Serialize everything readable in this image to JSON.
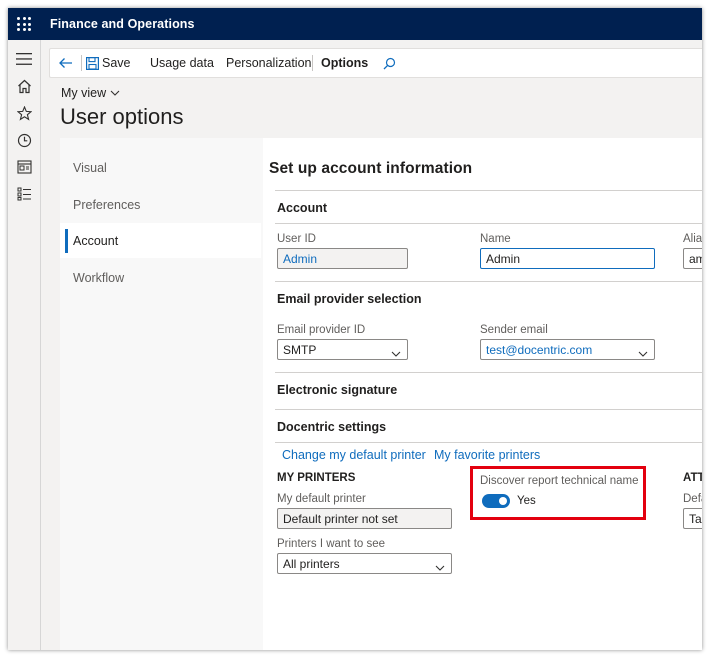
{
  "app": {
    "title": "Finance and Operations"
  },
  "action_pane": {
    "save_label": "Save",
    "usage_label": "Usage data",
    "personalization_label": "Personalization",
    "options_label": "Options"
  },
  "page": {
    "view_label": "My view",
    "title": "User options"
  },
  "tabs": [
    {
      "label": "Visual"
    },
    {
      "label": "Preferences"
    },
    {
      "label": "Account",
      "active": true
    },
    {
      "label": "Workflow"
    }
  ],
  "content": {
    "title": "Set up account information",
    "account": {
      "header": "Account",
      "user_id_label": "User ID",
      "user_id_value": "Admin",
      "name_label": "Name",
      "name_value": "Admin",
      "alias_label": "Alia",
      "alias_value": "am"
    },
    "email": {
      "header": "Email provider selection",
      "provider_label": "Email provider ID",
      "provider_value": "SMTP",
      "sender_label": "Sender email",
      "sender_value": "test@docentric.com"
    },
    "esig": {
      "header": "Electronic signature"
    },
    "docentric": {
      "header": "Docentric settings",
      "link_change_printer": "Change my default printer",
      "link_favorite_printers": "My favorite printers",
      "my_printers_header": "MY PRINTERS",
      "default_printer_label": "My default printer",
      "default_printer_value": "Default printer not set",
      "printers_see_label": "Printers I want to see",
      "printers_see_value": "All printers",
      "discover_label": "Discover report technical name",
      "discover_state": "Yes",
      "attach_header": "ATT",
      "attach_label": "Defa",
      "attach_value": "Tab"
    }
  },
  "colors": {
    "topbar": "#002050",
    "accent": "#0f6cbd",
    "highlight_border": "#e3000f"
  }
}
